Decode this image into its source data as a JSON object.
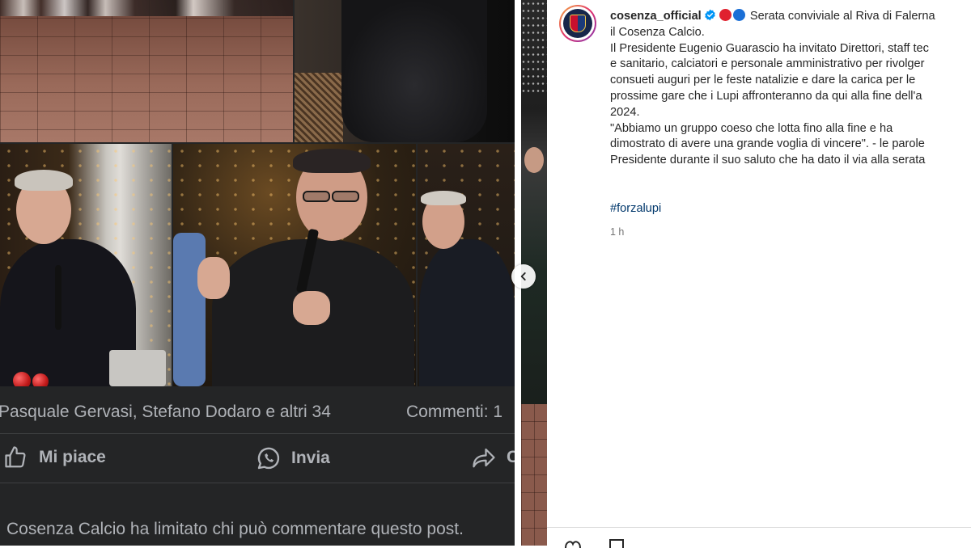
{
  "facebook": {
    "reactions_text": "Pasquale Gervasi, Stefano Dodaro e altri 34",
    "comments_text": "Commenti: 1",
    "actions": {
      "like_label": "Mi piace",
      "share_label": "Invia"
    },
    "restriction_notice": "Cosenza Calcio ha limitato chi può commentare questo post."
  },
  "instagram": {
    "username": "cosenza_official",
    "caption_intro": " Serata conviviale al Riva di Falerna\nil Cosenza Calcio.\nIl Presidente Eugenio Guarascio ha invitato Direttori, staff tec\ne sanitario, calciatori e personale amministrativo per rivolger\nconsueti auguri per le feste natalizie e dare la carica per le\nprossime gare che i Lupi affronteranno da qui alla fine dell'a\n2024.\n\"Abbiamo un gruppo coeso che lotta fino alla fine e ha\ndimostrato di avere una grande voglia di vincere\". - le parole\nPresidente durante il suo saluto che ha dato il via alla serata",
    "hashtag": "#forzalupi",
    "time_ago": "1 h",
    "dot_colors": [
      "#e0212f",
      "#1b6fd6"
    ]
  },
  "colors": {
    "fb_background": "#242526",
    "fb_text": "#b0b3b8",
    "ig_link": "#00376b",
    "verified_blue": "#0095f6"
  }
}
